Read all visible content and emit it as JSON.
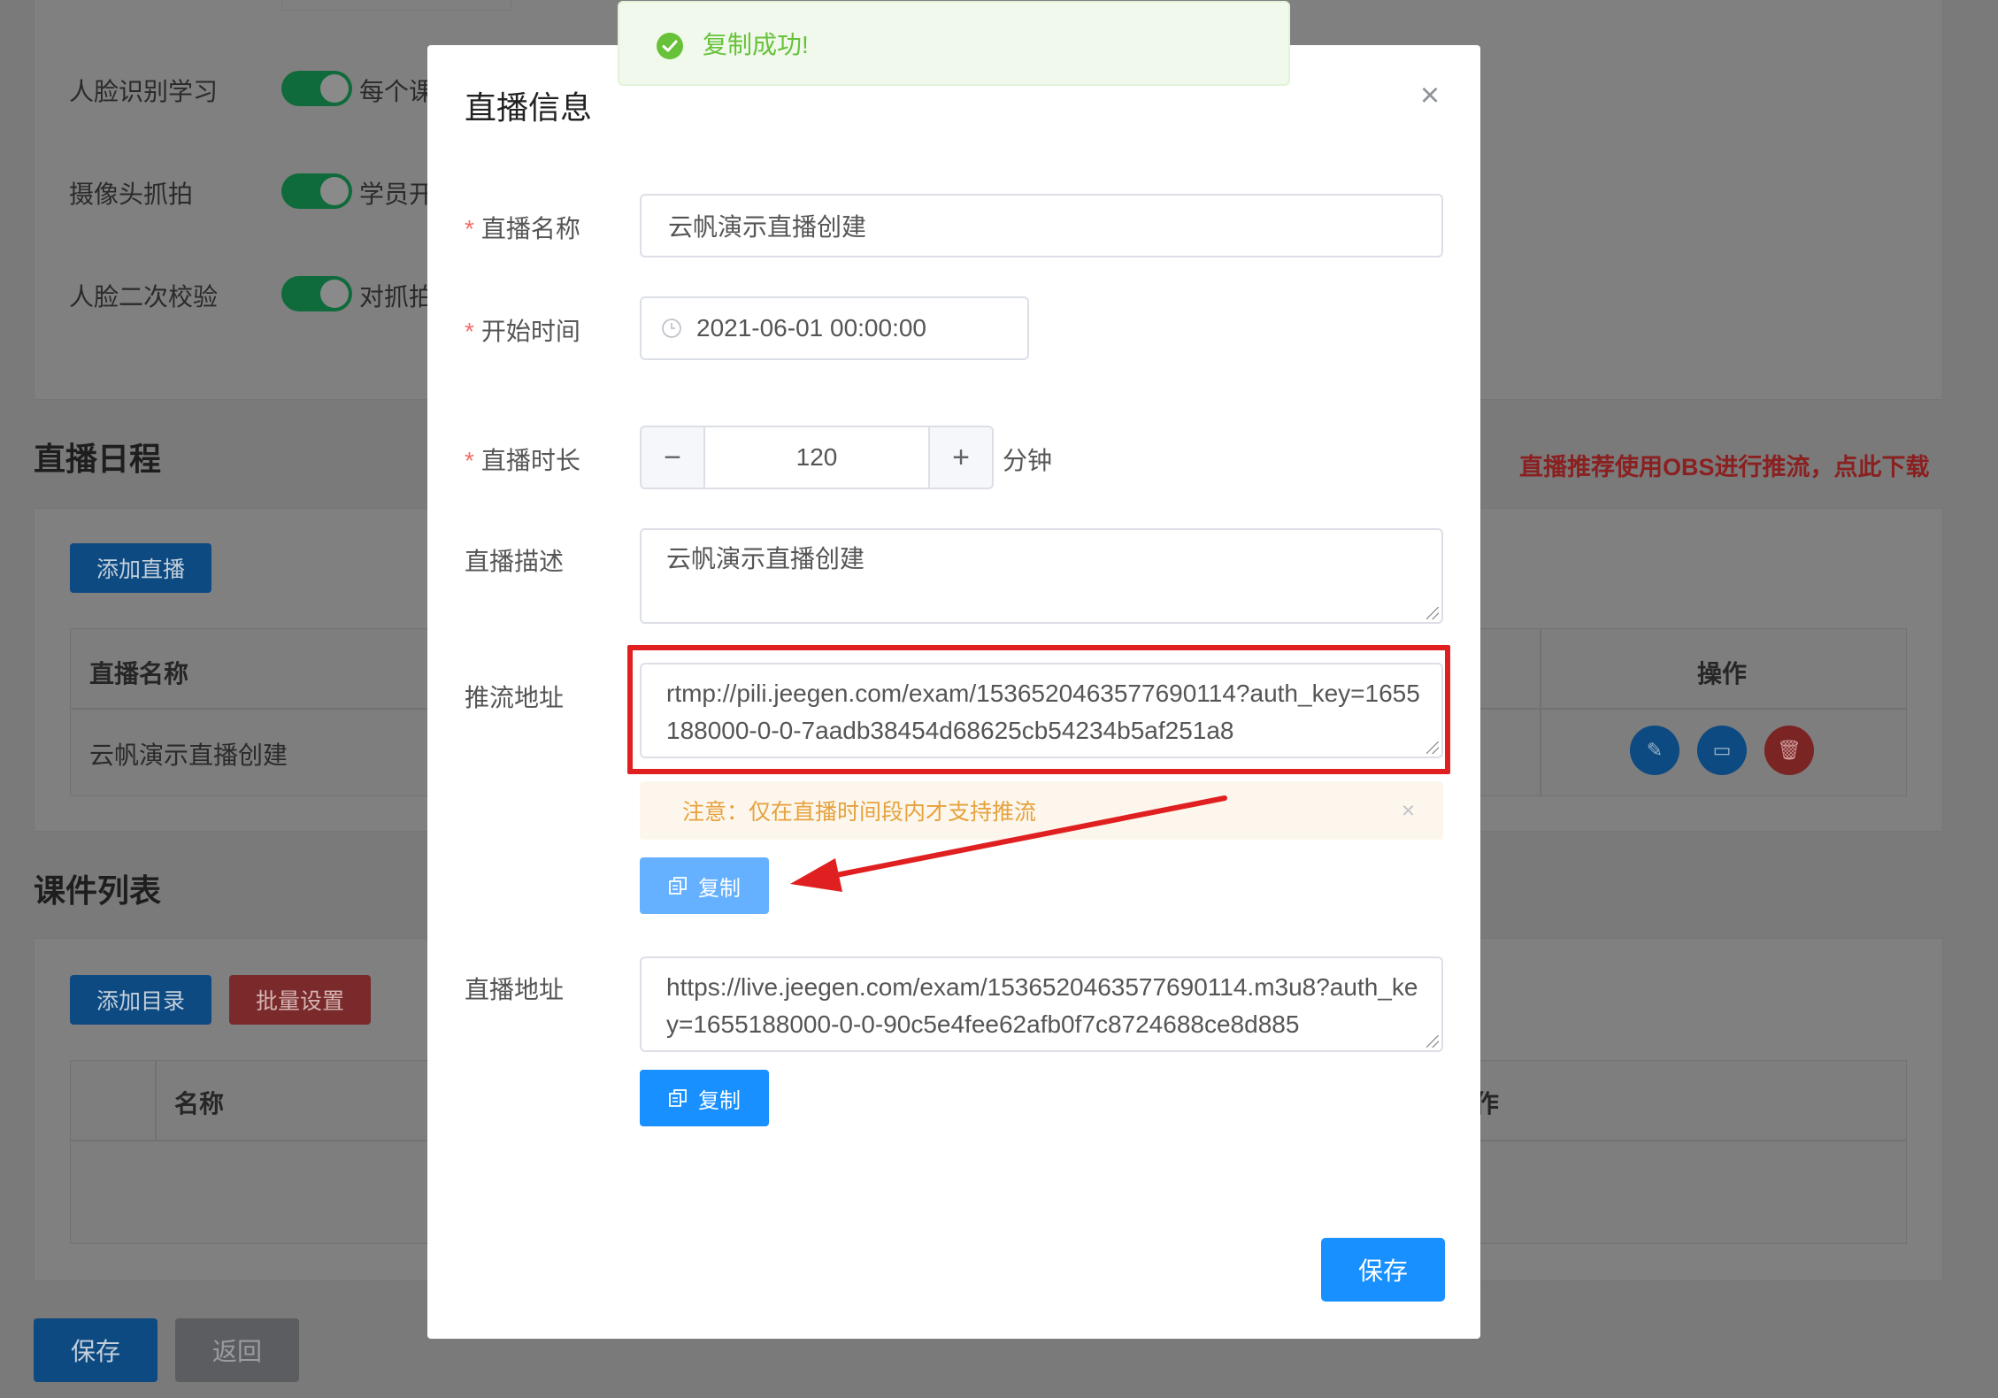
{
  "background": {
    "settings": [
      {
        "label": "人脸识别学习",
        "desc": "每个课"
      },
      {
        "label": "摄像头抓拍",
        "desc": "学员开"
      },
      {
        "label": "人脸二次校验",
        "desc": "对抓拍"
      }
    ],
    "schedule": {
      "title": "直播日程",
      "obs_tip": "直播推荐使用OBS进行推流，点此下载",
      "add_button": "添加直播",
      "col_name": "直播名称",
      "col_action": "操作",
      "row_name": "云帆演示直播创建"
    },
    "courseware": {
      "title": "课件列表",
      "add_dir_button": "添加目录",
      "batch_button": "批量设置",
      "col_name": "名称",
      "col_action_partial": "作"
    },
    "footer": {
      "save_label": "保存",
      "back_label": "返回"
    }
  },
  "toast": {
    "message": "复制成功!",
    "color": "#67c23a"
  },
  "dialog": {
    "title": "直播信息",
    "fields": {
      "name_label": "直播名称",
      "name_value": "云帆演示直播创建",
      "start_label": "开始时间",
      "start_value": "2021-06-01 00:00:00",
      "duration_label": "直播时长",
      "duration_value": "120",
      "duration_unit": "分钟",
      "desc_label": "直播描述",
      "desc_value": "云帆演示直播创建",
      "push_label": "推流地址",
      "push_value": "rtmp://pili.jeegen.com/exam/1536520463577690114?auth_key=1655188000-0-0-7aadb38454d68625cb54234b5af251a8",
      "push_notice": "注意：仅在直播时间段内才支持推流",
      "copy_label": "复制",
      "play_label": "直播地址",
      "play_value": "https://live.jeegen.com/exam/1536520463577690114.m3u8?auth_key=1655188000-0-0-90c5e4fee62afb0f7c8724688ce8d885",
      "copy_label_2": "复制"
    },
    "save_label": "保存",
    "accent_color": "#1890ff",
    "annotation_color": "#e02020"
  }
}
